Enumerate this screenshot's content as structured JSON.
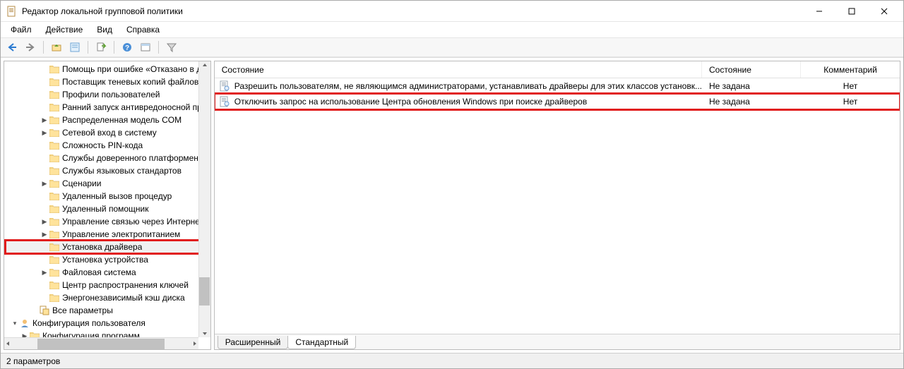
{
  "window": {
    "title": "Редактор локальной групповой политики"
  },
  "menu": {
    "file": "Файл",
    "action": "Действие",
    "view": "Вид",
    "help": "Справка"
  },
  "tree": {
    "items": [
      {
        "indent": 3,
        "exp": "",
        "label": "Помощь при ошибке «Отказано в до"
      },
      {
        "indent": 3,
        "exp": "",
        "label": "Поставщик теневых копий файловог"
      },
      {
        "indent": 3,
        "exp": "",
        "label": "Профили пользователей"
      },
      {
        "indent": 3,
        "exp": "",
        "label": "Ранний запуск антивредоносной про"
      },
      {
        "indent": 3,
        "exp": ">",
        "label": "Распределенная модель COM"
      },
      {
        "indent": 3,
        "exp": ">",
        "label": "Сетевой вход в систему"
      },
      {
        "indent": 3,
        "exp": "",
        "label": "Сложность PIN-кода"
      },
      {
        "indent": 3,
        "exp": "",
        "label": "Службы доверенного платформенно"
      },
      {
        "indent": 3,
        "exp": "",
        "label": "Службы языковых стандартов"
      },
      {
        "indent": 3,
        "exp": ">",
        "label": "Сценарии"
      },
      {
        "indent": 3,
        "exp": "",
        "label": "Удаленный вызов процедур"
      },
      {
        "indent": 3,
        "exp": "",
        "label": "Удаленный помощник"
      },
      {
        "indent": 3,
        "exp": ">",
        "label": "Управление связью через Интернет"
      },
      {
        "indent": 3,
        "exp": ">",
        "label": "Управление электропитанием"
      },
      {
        "indent": 3,
        "exp": "",
        "label": "Установка драйвера",
        "selected": true
      },
      {
        "indent": 3,
        "exp": "",
        "label": "Установка устройства"
      },
      {
        "indent": 3,
        "exp": ">",
        "label": "Файловая система"
      },
      {
        "indent": 3,
        "exp": "",
        "label": "Центр распространения ключей"
      },
      {
        "indent": 3,
        "exp": "",
        "label": "Энергонезависимый кэш диска"
      },
      {
        "indent": 2,
        "exp": "",
        "icon": "params",
        "label": "Все параметры"
      },
      {
        "indent": 0,
        "exp": "v",
        "icon": "user",
        "label": "Конфигурация пользователя"
      },
      {
        "indent": 1,
        "exp": ">",
        "label": "Конфигурация программ"
      }
    ]
  },
  "list": {
    "columns": {
      "name": "Состояние",
      "state": "Состояние",
      "comment": "Комментарий"
    },
    "rows": [
      {
        "name": "Разрешить пользователям, не являющимся администраторами, устанавливать драйверы для этих классов установк...",
        "state": "Не задана",
        "comment": "Нет",
        "highlight": false
      },
      {
        "name": "Отключить запрос на использование Центра обновления Windows при поиске драйверов",
        "state": "Не задана",
        "comment": "Нет",
        "highlight": true
      }
    ]
  },
  "tabs": {
    "extended": "Расширенный",
    "standard": "Стандартный"
  },
  "status": {
    "text": "2 параметров"
  }
}
